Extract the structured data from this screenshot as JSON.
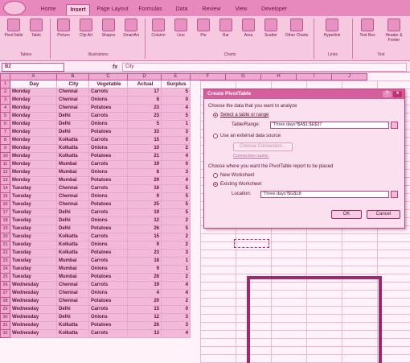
{
  "ribbon": {
    "tabs": [
      "Home",
      "Insert",
      "Page Layout",
      "Formulas",
      "Data",
      "Review",
      "View",
      "Developer"
    ],
    "active_tab": "Insert",
    "buttons": [
      "PivotTable",
      "Table",
      "Picture",
      "Clip Art",
      "Shapes",
      "SmartArt",
      "Column",
      "Line",
      "Pie",
      "Bar",
      "Area",
      "Scatter",
      "Other Charts",
      "Hyperlink",
      "Text Box",
      "Header & Footer"
    ],
    "groups": [
      "Tables",
      "Illustrations",
      "Charts",
      "Links",
      "Text"
    ]
  },
  "formula_bar": {
    "name_box": "B2",
    "fx": "fx",
    "content": "City"
  },
  "grid": {
    "columns": [
      "A",
      "B",
      "C",
      "D",
      "E",
      "F",
      "G",
      "H",
      "I",
      "J"
    ],
    "headers": [
      "Day",
      "City",
      "Vegetable",
      "Actual",
      "Surplus"
    ],
    "rows": [
      [
        "Monday",
        "Chennai",
        "Carrots",
        "17",
        "5"
      ],
      [
        "Monday",
        "Chennai",
        "Onions",
        "8",
        "0"
      ],
      [
        "Monday",
        "Chennai",
        "Potatoes",
        "23",
        "4"
      ],
      [
        "Monday",
        "Delhi",
        "Carrots",
        "23",
        "5"
      ],
      [
        "Monday",
        "Delhi",
        "Onions",
        "5",
        "1"
      ],
      [
        "Monday",
        "Delhi",
        "Potatoes",
        "33",
        "3"
      ],
      [
        "Monday",
        "Kolkatta",
        "Carrots",
        "15",
        "0"
      ],
      [
        "Monday",
        "Kolkatta",
        "Onions",
        "10",
        "2"
      ],
      [
        "Monday",
        "Kolkatta",
        "Potatoes",
        "21",
        "4"
      ],
      [
        "Monday",
        "Mumbai",
        "Carrots",
        "19",
        "0"
      ],
      [
        "Monday",
        "Mumbai",
        "Onions",
        "8",
        "3"
      ],
      [
        "Monday",
        "Mumbai",
        "Potatoes",
        "29",
        "4"
      ],
      [
        "Tuesday",
        "Chennai",
        "Carrots",
        "16",
        "5"
      ],
      [
        "Tuesday",
        "Chennai",
        "Onions",
        "9",
        "5"
      ],
      [
        "Tuesday",
        "Chennai",
        "Potatoes",
        "25",
        "5"
      ],
      [
        "Tuesday",
        "Delhi",
        "Carrots",
        "19",
        "5"
      ],
      [
        "Tuesday",
        "Delhi",
        "Onions",
        "12",
        "2"
      ],
      [
        "Tuesday",
        "Delhi",
        "Potatoes",
        "26",
        "5"
      ],
      [
        "Tuesday",
        "Kolkatta",
        "Carrots",
        "15",
        "2"
      ],
      [
        "Tuesday",
        "Kolkatta",
        "Onions",
        "9",
        "2"
      ],
      [
        "Tuesday",
        "Kolkatta",
        "Potatoes",
        "23",
        "3"
      ],
      [
        "Tuesday",
        "Mumbai",
        "Carrots",
        "18",
        "1"
      ],
      [
        "Tuesday",
        "Mumbai",
        "Onions",
        "9",
        "1"
      ],
      [
        "Tuesday",
        "Mumbai",
        "Potatoes",
        "26",
        "2"
      ],
      [
        "Wednesday",
        "Chennai",
        "Carrots",
        "19",
        "4"
      ],
      [
        "Wednesday",
        "Chennai",
        "Onions",
        "4",
        "4"
      ],
      [
        "Wednesday",
        "Chennai",
        "Potatoes",
        "20",
        "2"
      ],
      [
        "Wednesday",
        "Delhi",
        "Carrots",
        "15",
        "0"
      ],
      [
        "Wednesday",
        "Delhi",
        "Onions",
        "12",
        "3"
      ],
      [
        "Wednesday",
        "Kolkatta",
        "Potatoes",
        "26",
        "3"
      ],
      [
        "Wednesday",
        "Kolkatta",
        "Carrots",
        "13",
        "4"
      ]
    ]
  },
  "dialog": {
    "title": "Create PivotTable",
    "choose_data_label": "Choose the data that you want to analyze",
    "select_table_label": "Select a table or range",
    "table_range_label": "Table/Range:",
    "table_range_value": "'Three days'!$A$1:$E$37",
    "external_source_label": "Use an external data source",
    "choose_connection_label": "Choose Connection...",
    "connection_name_label": "Connection name:",
    "placement_label": "Choose where you want the PivotTable report to be placed",
    "new_worksheet_label": "New Worksheet",
    "existing_worksheet_label": "Existing Worksheet",
    "location_label": "Location:",
    "location_value": "'Three days'!$G$18",
    "ok_label": "OK",
    "cancel_label": "Cancel",
    "help_glyph": "?",
    "close_glyph": "x"
  }
}
